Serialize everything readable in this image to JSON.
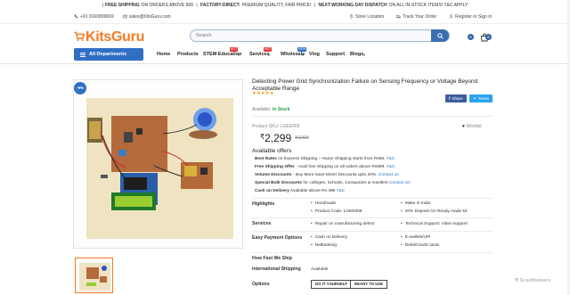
{
  "top_strip": {
    "item1_bold": "FREE SHIPPING",
    "item1_rest": "ON ORDERS ABOVE 999",
    "item2_bold": "FACTORY-DIRECT:",
    "item2_rest": "PREMIUM QUALITY, FAIR PRICE!",
    "item3_bold": "NEXT-WORKING DAY DISPATCH",
    "item3_rest": "ON ALL IN-STOCK ITEMS! T&C APPLY"
  },
  "util_bar": {
    "phone": "+91 9160809669",
    "email": "sales@KitsGuru.com",
    "store_location": "Store Location",
    "track_order": "Track Your Order",
    "auth": "Register or Sign in"
  },
  "header": {
    "logo": "KitsGuru",
    "search_placeholder": "Search",
    "wishlist_count": "0",
    "cart_count": "0"
  },
  "nav": {
    "all_departments": "All Departments",
    "items": [
      "Home",
      "Products",
      "STEM Education",
      "Services",
      "Wholesale",
      "Vlog",
      "Support",
      "Blogs"
    ],
    "tag_hot": "HOT",
    "tag_new": "NEW"
  },
  "product": {
    "discount": "-9%",
    "title": "Detecting Power Grid Synchronization Failure on Sensing Frequency or Voltage Beyond Acceptable Range",
    "stars": "★★★★★",
    "rating": 5,
    "share_label": "Share",
    "tweet_label": "Tweet",
    "availability_label": "Available:",
    "availability_value": "In Stock",
    "sku": "Product SKU: LGEE008",
    "wishlist": "Wishlist",
    "price": "2,299",
    "mrp": "2,999"
  },
  "offers": {
    "heading": "Available offers",
    "items": [
      {
        "bold": "Best Rates",
        "text": "on Express Shipping – Hurry! Shipping starts from Rs69.",
        "link": "T&C"
      },
      {
        "bold": "Free Shipping Offer",
        "text": "- Avail free shipping on all orders above Rs999.",
        "link": "T&C"
      },
      {
        "bold": "Volume Discounts",
        "text": "- Buy More Save More! Discounts upto 20%.",
        "link": "Contact us"
      },
      {
        "bold": "Special Bulk Discounts",
        "text": "for colleges, Schools, Companies & resellers",
        "link": "Contact Us"
      },
      {
        "bold": "Cash on Delivery",
        "text": "Available above Rs 499",
        "link": "T&C"
      }
    ]
  },
  "details": {
    "highlights_label": "Highlights",
    "highlights": [
      "Handmade",
      "Product Code: LGEE008",
      "Make in India",
      "20% Deposit On Ready made kit"
    ],
    "services_label": "Services",
    "services": [
      "Repair on manufacturing defect",
      "Technical Support: Video support"
    ],
    "payment_label": "Easy Payment Options",
    "payments": [
      "Cash on Delivery",
      "Netbanking",
      "E-wallets/UPI",
      "Debit/Credit cards"
    ],
    "ship_fast_label": "How Fast We Ship",
    "intl_label": "International Shipping",
    "intl_value": "Available",
    "options_label": "Options",
    "option_buttons": [
      "DO IT YOURSELF",
      "READY TO USE"
    ]
  },
  "watermark": "ScanMalware",
  "colors": {
    "brand_orange": "#f47b20",
    "brand_blue": "#2f6fc4",
    "in_stock_green": "#2a9c3f",
    "star": "#f5a623"
  }
}
